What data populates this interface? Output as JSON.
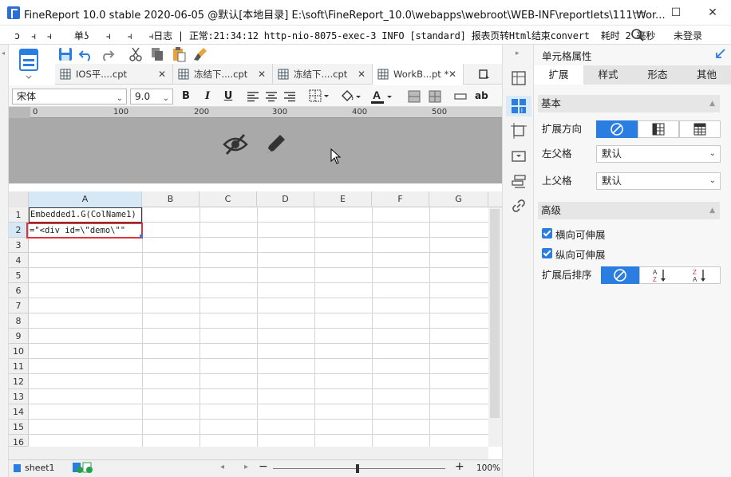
{
  "window": {
    "title": "FineReport 10.0 stable 2020-06-05 @默认[本地目录]     E:\\soft\\FineReport_10.0\\webapps\\webroot\\WEB-INF\\reportlets\\111\\Wor...",
    "minimize": "—",
    "maximize": "☐",
    "close": "✕"
  },
  "menubar": {
    "text": "ɔ  ⫞  ⫞    单ʖ   ⫞   ⫞   ⫞日志 | 正常:21:34:12 http-nio-8075-exec-3 INFO [standard] 报表页转Html结束convert  耗时 2 毫秒",
    "login": "未登录"
  },
  "tabs": [
    {
      "label": "IOS平....cpt",
      "close": "✕"
    },
    {
      "label": "冻结下....cpt",
      "close": "✕"
    },
    {
      "label": "冻结下....cpt",
      "close": "✕"
    },
    {
      "label": "WorkB...pt *",
      "close": "✕"
    }
  ],
  "format": {
    "font": "宋体",
    "size": "9.0",
    "bold": "B",
    "italic": "I",
    "underline": "U",
    "wrap": "ab"
  },
  "ruler": [
    "0",
    "100",
    "200",
    "300",
    "400",
    "500"
  ],
  "grid": {
    "columns": [
      "A",
      "B",
      "C",
      "D",
      "E",
      "F",
      "G"
    ],
    "rows": [
      "1",
      "2",
      "3",
      "4",
      "5",
      "6",
      "7",
      "8",
      "9",
      "10",
      "11",
      "12",
      "13",
      "14",
      "15",
      "16"
    ],
    "a1": "Embedded1.G(ColName1)",
    "a2": "=\"<div id=\\\"demo\\\"\""
  },
  "sheet": {
    "name": "sheet1",
    "zoom": "100%",
    "minus": "−",
    "plus": "+"
  },
  "panel": {
    "title": "单元格属性",
    "tabs": [
      "扩展",
      "样式",
      "形态",
      "其他"
    ],
    "basic": "基本",
    "expand_dir": "扩展方向",
    "left_parent": "左父格",
    "left_parent_value": "默认",
    "up_parent": "上父格",
    "up_parent_value": "默认",
    "advanced": "高级",
    "h_expand": "横向可伸展",
    "v_expand": "纵向可伸展",
    "sort_after": "扩展后排序"
  },
  "colors": {
    "accent": "#2a7de1",
    "selection_border": "#e0323a",
    "design_bg": "#a9a9a9"
  }
}
